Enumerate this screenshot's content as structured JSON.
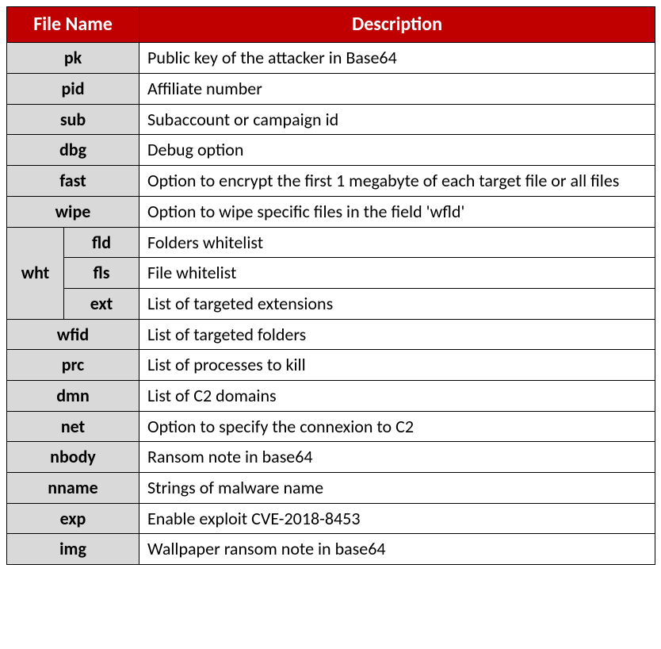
{
  "headers": {
    "file_name": "File Name",
    "description": "Description"
  },
  "rows": {
    "pk": {
      "name": "pk",
      "desc": "Public key of the attacker in Base64"
    },
    "pid": {
      "name": "pid",
      "desc": "Affiliate number"
    },
    "sub": {
      "name": "sub",
      "desc": "Subaccount or campaign id"
    },
    "dbg": {
      "name": "dbg",
      "desc": "Debug option"
    },
    "fast": {
      "name": "fast",
      "desc": "Option to encrypt the first 1 megabyte of each target file or all files"
    },
    "wipe": {
      "name": "wipe",
      "desc": "Option to wipe specific files in the field 'wfld'"
    },
    "wht": {
      "name": "wht"
    },
    "fld": {
      "name": "fld",
      "desc": "Folders whitelist"
    },
    "fls": {
      "name": "fls",
      "desc": "File whitelist"
    },
    "ext": {
      "name": "ext",
      "desc": "List of targeted extensions"
    },
    "wfid": {
      "name": "wfid",
      "desc": "List of targeted folders"
    },
    "prc": {
      "name": "prc",
      "desc": "List of processes to kill"
    },
    "dmn": {
      "name": "dmn",
      "desc": "List of C2 domains"
    },
    "net": {
      "name": "net",
      "desc": "Option to specify the connexion to C2"
    },
    "nbody": {
      "name": "nbody",
      "desc": "Ransom note in base64"
    },
    "nname": {
      "name": "nname",
      "desc": "Strings of malware name"
    },
    "exp": {
      "name": "exp",
      "desc": "Enable exploit CVE-2018-8453"
    },
    "img": {
      "name": "img",
      "desc": "Wallpaper ransom note in base64"
    }
  }
}
